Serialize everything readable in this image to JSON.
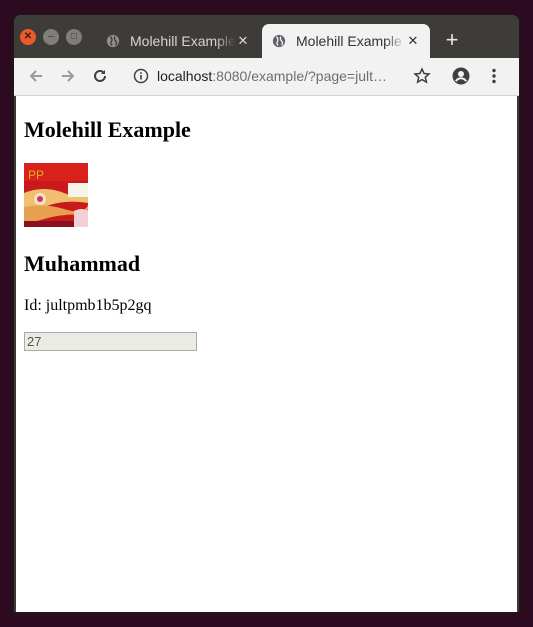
{
  "window": {
    "controls": [
      "close-icon",
      "minimize-icon",
      "maximize-icon"
    ]
  },
  "tabs": [
    {
      "title": "Molehill Example",
      "icon": "globe-icon",
      "active": false
    },
    {
      "title": "Molehill Example",
      "icon": "globe-icon",
      "active": true
    }
  ],
  "toolbar": {
    "url_host": "localhost",
    "url_rest": ":8080/example/?page=jult…",
    "icons": [
      "back-icon",
      "forward-icon",
      "reload-icon",
      "info-icon",
      "star-icon",
      "account-icon",
      "menu-icon"
    ]
  },
  "page": {
    "heading": "Molehill Example",
    "name": "Muhammad",
    "id_text": "Id: jultpmb1b5p2gq",
    "field_value": "27"
  },
  "colors": {
    "desktop": "#2c0a1f",
    "titlebar": "#3d3c38",
    "close": "#e95b2c"
  }
}
